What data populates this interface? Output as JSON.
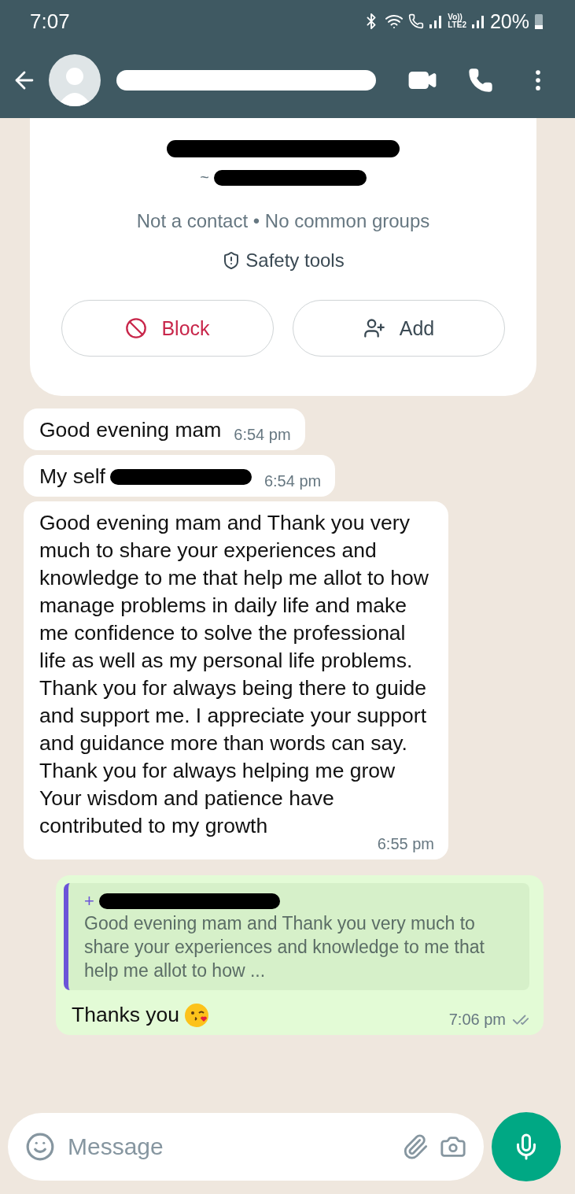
{
  "status_bar": {
    "time": "7:07",
    "volte_label": "Vo))",
    "lte_label": "LTE2",
    "battery": "20%"
  },
  "contact_card": {
    "name_prefix": "~",
    "info": "Not a contact • No common groups",
    "safety": "Safety tools",
    "buttons": [
      {
        "label": "Block",
        "kind": "block"
      },
      {
        "label": "Add",
        "kind": "add"
      }
    ]
  },
  "messages": [
    {
      "kind": "incoming",
      "text": "Good evening mam",
      "time": "6:54 pm",
      "redacted": false
    },
    {
      "kind": "incoming",
      "text": "My self",
      "time": "6:54 pm",
      "redacted": true
    },
    {
      "kind": "incoming",
      "text": "Good evening mam and Thank you very much to share your experiences and knowledge to me that help me allot to how manage problems in daily life and make me confidence to solve the professional life as well as my personal life problems. Thank you for always being there to guide and support me. I appreciate your support and guidance more than words can say. Thank you for always helping me grow Your wisdom and patience have contributed to my growth",
      "time": "6:55 pm",
      "redacted": false
    },
    {
      "kind": "outgoing",
      "quote": {
        "author_prefix": "+",
        "text": "Good evening mam and Thank you very much to share your experiences and knowledge to me that help me allot to how ..."
      },
      "text": "Thanks you",
      "time": "7:06 pm",
      "redacted": false
    }
  ],
  "composer": {
    "placeholder": "Message"
  }
}
